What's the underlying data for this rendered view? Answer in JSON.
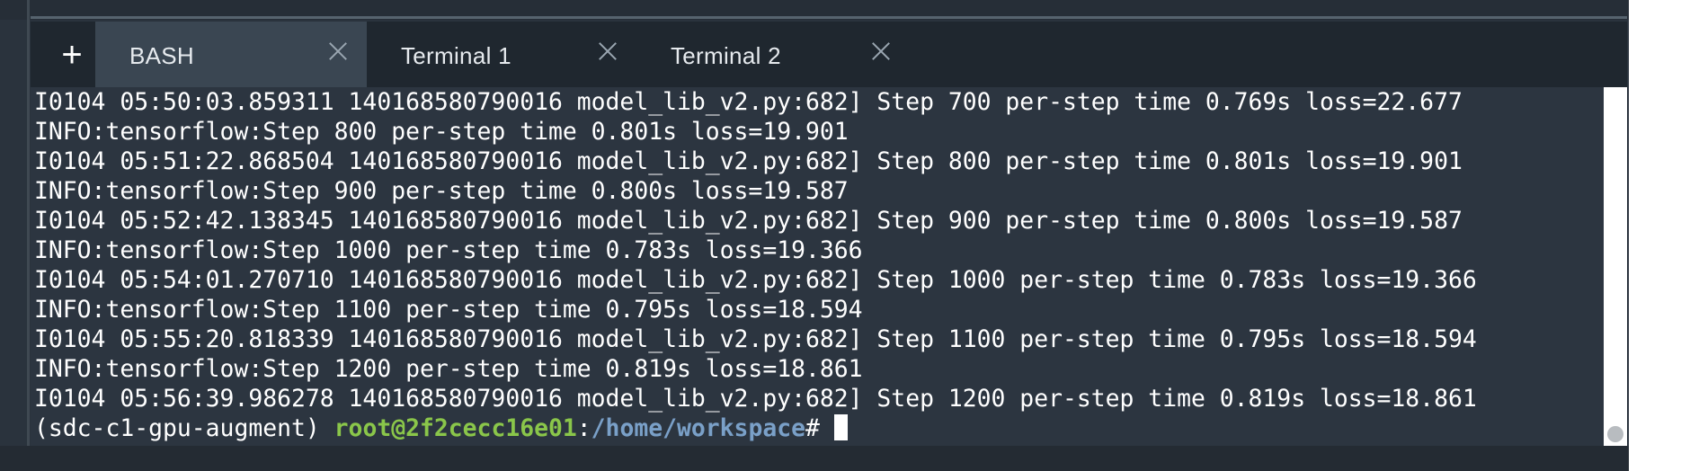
{
  "tabs": {
    "add_label": "+",
    "items": [
      {
        "label": "BASH",
        "active": true
      },
      {
        "label": "Terminal 1",
        "active": false
      },
      {
        "label": "Terminal 2",
        "active": false
      }
    ]
  },
  "terminal": {
    "lines": [
      "I0104 05:50:03.859311 140168580790016 model_lib_v2.py:682] Step 700 per-step time 0.769s loss=22.677",
      "INFO:tensorflow:Step 800 per-step time 0.801s loss=19.901",
      "I0104 05:51:22.868504 140168580790016 model_lib_v2.py:682] Step 800 per-step time 0.801s loss=19.901",
      "INFO:tensorflow:Step 900 per-step time 0.800s loss=19.587",
      "I0104 05:52:42.138345 140168580790016 model_lib_v2.py:682] Step 900 per-step time 0.800s loss=19.587",
      "INFO:tensorflow:Step 1000 per-step time 0.783s loss=19.366",
      "I0104 05:54:01.270710 140168580790016 model_lib_v2.py:682] Step 1000 per-step time 0.783s loss=19.366",
      "INFO:tensorflow:Step 1100 per-step time 0.795s loss=18.594",
      "I0104 05:55:20.818339 140168580790016 model_lib_v2.py:682] Step 1100 per-step time 0.795s loss=18.594",
      "INFO:tensorflow:Step 1200 per-step time 0.819s loss=18.861",
      "I0104 05:56:39.986278 140168580790016 model_lib_v2.py:682] Step 1200 per-step time 0.819s loss=18.861"
    ],
    "prompt": {
      "env": "(sdc-c1-gpu-augment) ",
      "user_host": "root@2f2cecc16e01",
      "separator": ":",
      "path": "/home/workspace",
      "symbol": "#"
    }
  },
  "colors": {
    "prompt_user": "#8ac64a",
    "prompt_path": "#7aa0c8",
    "terminal_bg": "#2c3540",
    "active_tab_bg": "#3a4652"
  }
}
